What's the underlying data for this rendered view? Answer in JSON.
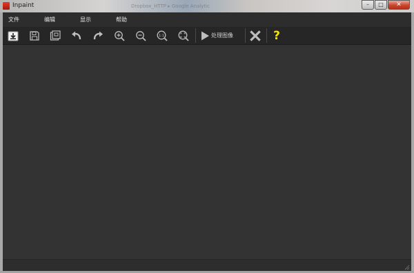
{
  "window": {
    "title": "Inpaint",
    "background_hint": "Dropbox_HTTP   ▸   Google Analytic",
    "controls": {
      "minimize": "–",
      "maximize": "□",
      "close": "✕"
    }
  },
  "menu": {
    "items": [
      {
        "label": "文件"
      },
      {
        "label": "编辑"
      },
      {
        "label": "显示"
      },
      {
        "label": "帮助"
      }
    ]
  },
  "toolbar": {
    "buttons": [
      {
        "name": "open",
        "icon": "open-image-icon"
      },
      {
        "name": "save",
        "icon": "save-icon"
      },
      {
        "name": "save-as",
        "icon": "save-as-icon"
      },
      {
        "name": "undo",
        "icon": "undo-icon"
      },
      {
        "name": "redo",
        "icon": "redo-icon"
      },
      {
        "name": "zoom-in",
        "icon": "zoom-in-icon"
      },
      {
        "name": "zoom-out",
        "icon": "zoom-out-icon"
      },
      {
        "name": "zoom-actual",
        "icon": "zoom-actual-size-icon",
        "text": "1:1"
      },
      {
        "name": "zoom-fit",
        "icon": "zoom-fit-icon"
      },
      {
        "name": "process",
        "icon": "play-icon"
      },
      {
        "name": "cancel",
        "icon": "close-x-icon"
      },
      {
        "name": "help",
        "icon": "help-icon",
        "text": "?"
      }
    ],
    "process_label": "处理图像"
  },
  "colors": {
    "canvas": "#333333",
    "toolbar": "#262626",
    "help_accent": "#f5e400",
    "icon_gray": "#bdbdbd"
  }
}
